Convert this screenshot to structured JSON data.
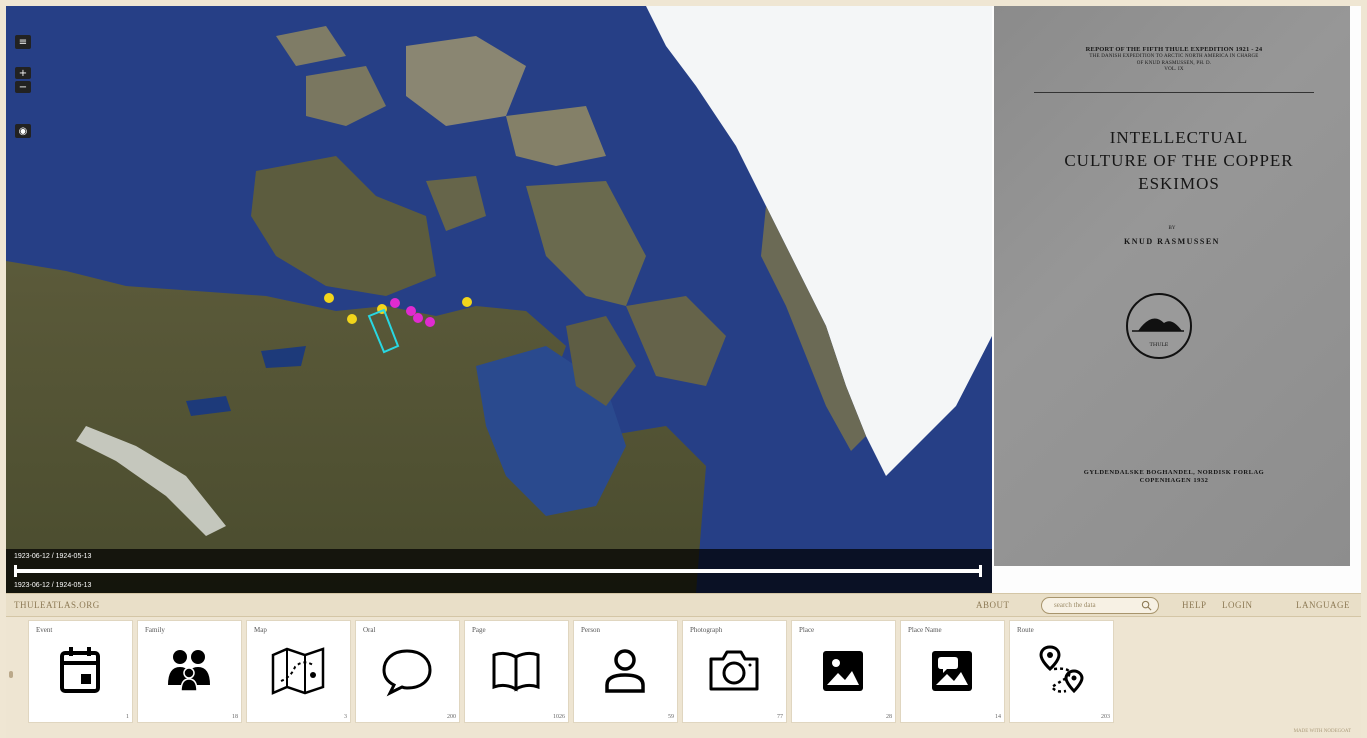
{
  "map": {
    "controls": {
      "layers_icon": "layers-icon",
      "zoom_in": "+",
      "zoom_out": "−",
      "basemap_icon": "globe-icon"
    },
    "timeline": {
      "top_range": "1923-06-12 / 1924-05-13",
      "bottom_range": "1923-06-12 / 1924-05-13"
    }
  },
  "document": {
    "header_line1": "REPORT OF THE FIFTH THULE EXPEDITION 1921 - 24",
    "header_line2": "THE DANISH EXPEDITION TO ARCTIC NORTH AMERICA IN CHARGE",
    "header_line3": "OF KNUD RASMUSSEN, PH. D.",
    "header_line4": "VOL. IX",
    "title_line1": "INTELLECTUAL",
    "title_line2": "CULTURE OF THE COPPER",
    "title_line3": "ESKIMOS",
    "by": "BY",
    "author": "KNUD RASMUSSEN",
    "seal_text": "THULE",
    "publisher_line1": "GYLDENDALSKE BOGHANDEL, NORDISK FORLAG",
    "publisher_line2": "COPENHAGEN 1932"
  },
  "topbar": {
    "brand": "THULEATLAS.ORG",
    "about": "ABOUT",
    "search_placeholder": "search the data",
    "help": "HELP",
    "login": "LOGIN",
    "language": "LANGUAGE"
  },
  "cards": [
    {
      "label": "Event",
      "count": "1",
      "icon": "calendar-icon"
    },
    {
      "label": "Family",
      "count": "18",
      "icon": "family-icon"
    },
    {
      "label": "Map",
      "count": "3",
      "icon": "map-icon"
    },
    {
      "label": "Oral",
      "count": "200",
      "icon": "speech-bubble-icon"
    },
    {
      "label": "Page",
      "count": "1026",
      "icon": "book-icon"
    },
    {
      "label": "Person",
      "count": "59",
      "icon": "person-icon"
    },
    {
      "label": "Photograph",
      "count": "77",
      "icon": "camera-icon"
    },
    {
      "label": "Place",
      "count": "28",
      "icon": "image-icon"
    },
    {
      "label": "Place Name",
      "count": "14",
      "icon": "image-comment-icon"
    },
    {
      "label": "Route",
      "count": "203",
      "icon": "route-icon"
    }
  ],
  "footer_credit": "MADE WITH NODEGOAT"
}
